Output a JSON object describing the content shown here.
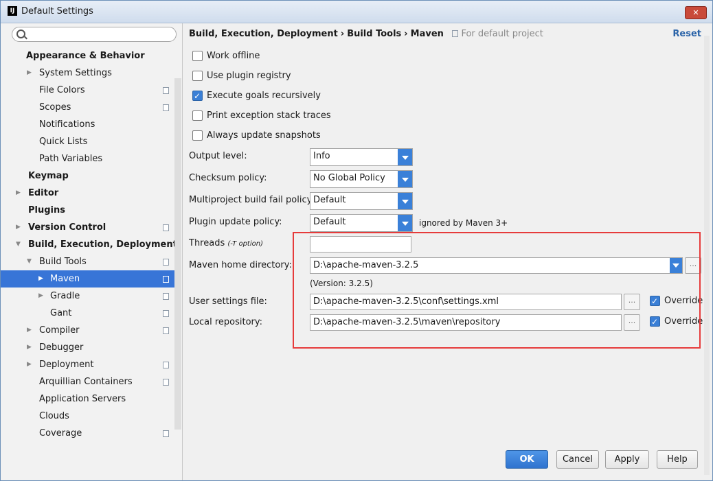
{
  "window": {
    "title": "Default Settings",
    "app_icon": "IJ",
    "close_label": "✕"
  },
  "sidebar": {
    "search": {
      "placeholder": "",
      "value": ""
    },
    "items": [
      {
        "label": "Appearance & Behavior"
      },
      {
        "label": "System Settings"
      },
      {
        "label": "File Colors"
      },
      {
        "label": "Scopes"
      },
      {
        "label": "Notifications"
      },
      {
        "label": "Quick Lists"
      },
      {
        "label": "Path Variables"
      },
      {
        "label": "Keymap"
      },
      {
        "label": "Editor"
      },
      {
        "label": "Plugins"
      },
      {
        "label": "Version Control"
      },
      {
        "label": "Build, Execution, Deployment"
      },
      {
        "label": "Build Tools"
      },
      {
        "label": "Maven"
      },
      {
        "label": "Gradle"
      },
      {
        "label": "Gant"
      },
      {
        "label": "Compiler"
      },
      {
        "label": "Debugger"
      },
      {
        "label": "Deployment"
      },
      {
        "label": "Arquillian Containers"
      },
      {
        "label": "Application Servers"
      },
      {
        "label": "Clouds"
      },
      {
        "label": "Coverage"
      }
    ]
  },
  "header": {
    "breadcrumb": [
      "Build, Execution, Deployment",
      "Build Tools",
      "Maven"
    ],
    "breadcrumb_sep": "›",
    "note": "For default project",
    "reset_label": "Reset"
  },
  "checkboxes": [
    {
      "label": "Work offline",
      "checked": false
    },
    {
      "label": "Use plugin registry",
      "checked": false
    },
    {
      "label": "Execute goals recursively",
      "checked": true
    },
    {
      "label": "Print exception stack traces",
      "checked": false
    },
    {
      "label": "Always update snapshots",
      "checked": false
    }
  ],
  "fields": {
    "output_level": {
      "label": "Output level:",
      "value": "Info"
    },
    "checksum_policy": {
      "label": "Checksum policy:",
      "value": "No Global Policy"
    },
    "multiproject_fail_policy": {
      "label": "Multiproject build fail policy:",
      "value": "Default"
    },
    "plugin_update_policy": {
      "label": "Plugin update policy:",
      "value": "Default",
      "note": "ignored by Maven 3+"
    },
    "threads": {
      "label": "Threads",
      "label_hint": "(-T option)",
      "value": ""
    },
    "maven_home": {
      "label": "Maven home directory:",
      "value": "D:\\apache-maven-3.2.5",
      "version": "(Version: 3.2.5)"
    },
    "user_settings": {
      "label": "User settings file:",
      "value": "D:\\apache-maven-3.2.5\\conf\\settings.xml",
      "override_label": "Override",
      "override_checked": true
    },
    "local_repo": {
      "label": "Local repository:",
      "value": "D:\\apache-maven-3.2.5\\maven\\repository",
      "override_label": "Override",
      "override_checked": true
    }
  },
  "browse_label": "...",
  "footer": {
    "ok": "OK",
    "cancel": "Cancel",
    "apply": "Apply",
    "help": "Help"
  },
  "colors": {
    "accent": "#3875d7",
    "highlight_box": "#e63b3b",
    "link": "#2a63a8"
  }
}
